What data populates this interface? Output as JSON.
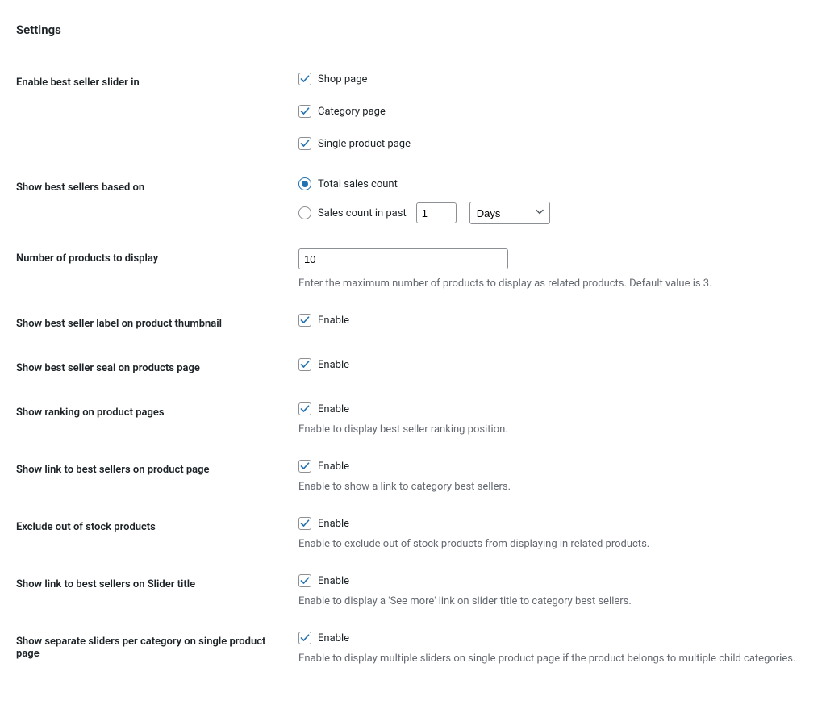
{
  "section_title": "Settings",
  "rows": {
    "enable_slider": {
      "label": "Enable best seller slider in",
      "options": [
        {
          "label": "Shop page",
          "checked": true
        },
        {
          "label": "Category page",
          "checked": true
        },
        {
          "label": "Single product page",
          "checked": true
        }
      ]
    },
    "based_on": {
      "label": "Show best sellers based on",
      "radios": [
        {
          "label": "Total sales count",
          "checked": true
        },
        {
          "label": "Sales count in past",
          "checked": false
        }
      ],
      "past_value": "1",
      "unit": "Days"
    },
    "num_products": {
      "label": "Number of products to display",
      "value": "10",
      "help": "Enter the maximum number of products to display as related products. Default value is 3."
    },
    "label_thumbnail": {
      "label": "Show best seller label on product thumbnail",
      "option_label": "Enable",
      "checked": true
    },
    "seal_page": {
      "label": "Show best seller seal on products page",
      "option_label": "Enable",
      "checked": true
    },
    "ranking": {
      "label": "Show ranking on product pages",
      "option_label": "Enable",
      "checked": true,
      "help": "Enable to display best seller ranking position."
    },
    "link_product": {
      "label": "Show link to best sellers on product page",
      "option_label": "Enable",
      "checked": true,
      "help": "Enable to show a link to category best sellers."
    },
    "exclude_oos": {
      "label": "Exclude out of stock products",
      "option_label": "Enable",
      "checked": true,
      "help": "Enable to exclude out of stock products from displaying in related products."
    },
    "link_slider": {
      "label": "Show link to best sellers on Slider title",
      "option_label": "Enable",
      "checked": true,
      "help": "Enable to display a 'See more' link on slider title to category best sellers."
    },
    "separate_sliders": {
      "label": "Show separate sliders per category on single product page",
      "option_label": "Enable",
      "checked": true,
      "help": "Enable to display multiple sliders on single product page if the product belongs to multiple child categories."
    }
  }
}
